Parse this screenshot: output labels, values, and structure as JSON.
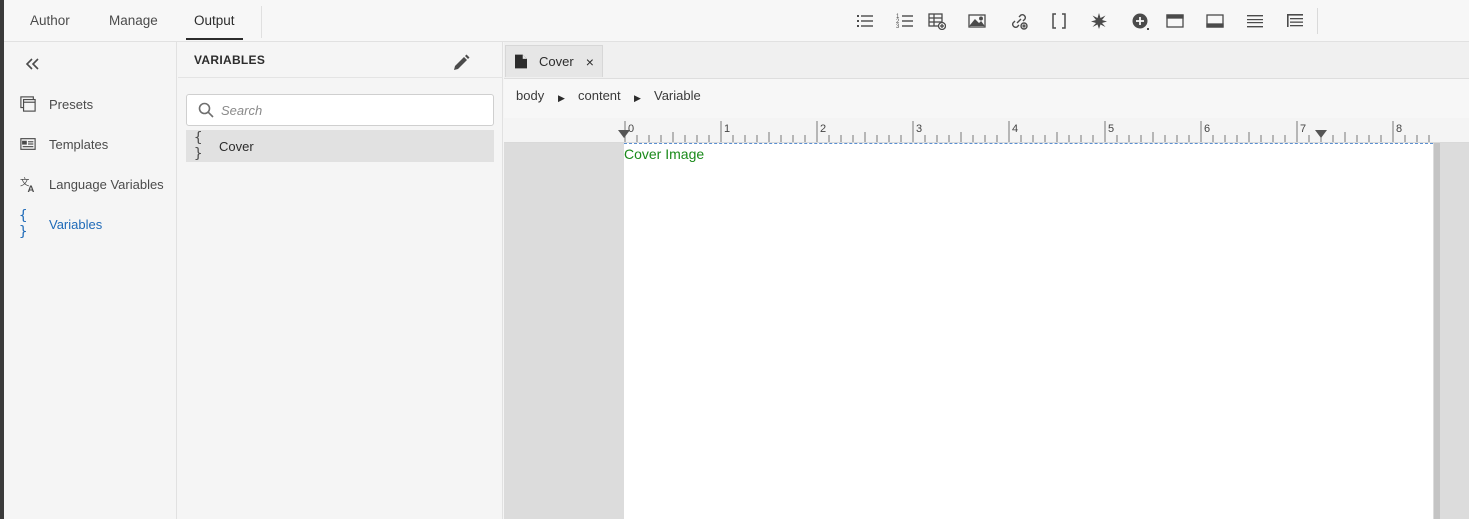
{
  "top_tabs": [
    {
      "label": "Author"
    },
    {
      "label": "Manage"
    },
    {
      "label": "Output"
    }
  ],
  "active_tab": "Output",
  "toolbar": {
    "tools": [
      "bulleted-list-icon",
      "numbered-list-icon",
      "insert-table-icon",
      "insert-image-icon",
      "insert-link-icon",
      "brackets-icon",
      "asterisk-icon",
      "add-circle-icon",
      "header-layout-icon",
      "footer-layout-icon",
      "page-break-icon",
      "toc-icon"
    ]
  },
  "nav": {
    "items": [
      {
        "label": "Presets",
        "icon": "presets-icon"
      },
      {
        "label": "Templates",
        "icon": "templates-icon"
      },
      {
        "label": "Language Variables",
        "icon": "language-icon"
      },
      {
        "label": "Variables",
        "icon": "braces-icon",
        "active": true
      }
    ]
  },
  "variables_panel": {
    "title": "VARIABLES",
    "search_placeholder": "Search",
    "items": [
      {
        "label": "Cover",
        "icon_text": "{ }"
      }
    ]
  },
  "editor": {
    "doc_tab": {
      "label": "Cover",
      "close_glyph": "×"
    },
    "breadcrumb": [
      "body",
      "content",
      "Variable"
    ],
    "breadcrumb_separator": "▶",
    "ruler_labels": [
      "0",
      "1",
      "2",
      "3",
      "4",
      "5",
      "6",
      "7",
      "8"
    ],
    "page_text": "Cover Image"
  },
  "colors": {
    "accent": "#1e6ab8",
    "page_text": "#1a8a1a"
  }
}
